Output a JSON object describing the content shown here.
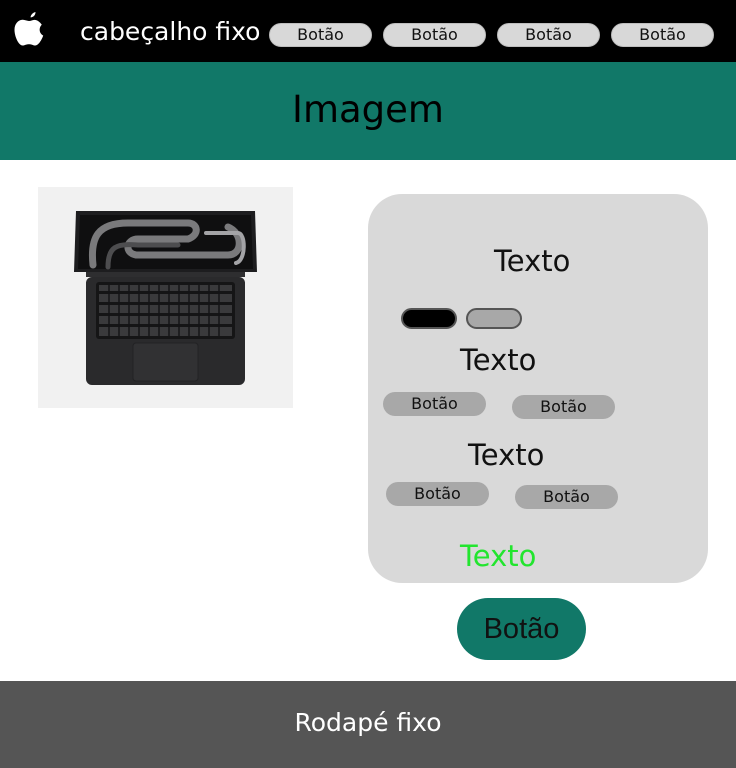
{
  "header": {
    "logo_icon": "apple-logo-icon",
    "title": "cabeçalho fixo",
    "nav_buttons": [
      "Botão",
      "Botão",
      "Botão",
      "Botão"
    ]
  },
  "banner": {
    "title": "Imagem"
  },
  "product": {
    "image": "laptop-image"
  },
  "card": {
    "heading": "Texto",
    "toggles": [
      {
        "state": "on"
      },
      {
        "state": "off"
      }
    ],
    "section1": {
      "title": "Texto",
      "buttons": [
        "Botão",
        "Botão"
      ]
    },
    "section2": {
      "title": "Texto",
      "buttons": [
        "Botão",
        "Botão"
      ]
    },
    "highlight_text": "Texto"
  },
  "cta": {
    "label": "Botão"
  },
  "footer": {
    "text": "Rodapé fixo"
  },
  "colors": {
    "header_bg": "#000000",
    "accent": "#117868",
    "card_bg": "#d9d9d9",
    "highlight": "#22e52e",
    "footer_bg": "#555555"
  }
}
